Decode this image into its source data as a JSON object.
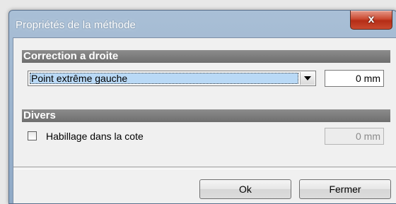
{
  "window": {
    "title": "Propriétés de la méthode",
    "close_glyph": "x"
  },
  "section_correction": {
    "header": "Correction a droite",
    "dropdown_value": "Point extrême gauche",
    "value_input": "0 mm"
  },
  "section_divers": {
    "header": "Divers",
    "checkbox_label": "Habillage dans la cote",
    "checkbox_checked": false,
    "value_input": "0 mm",
    "value_input_disabled": true
  },
  "buttons": {
    "ok_label": "Ok",
    "close_label": "Fermer"
  },
  "colors": {
    "section_header_bg": "#7d7d7d",
    "selection_highlight": "#b9d9f6",
    "close_button": "#c7452c"
  }
}
